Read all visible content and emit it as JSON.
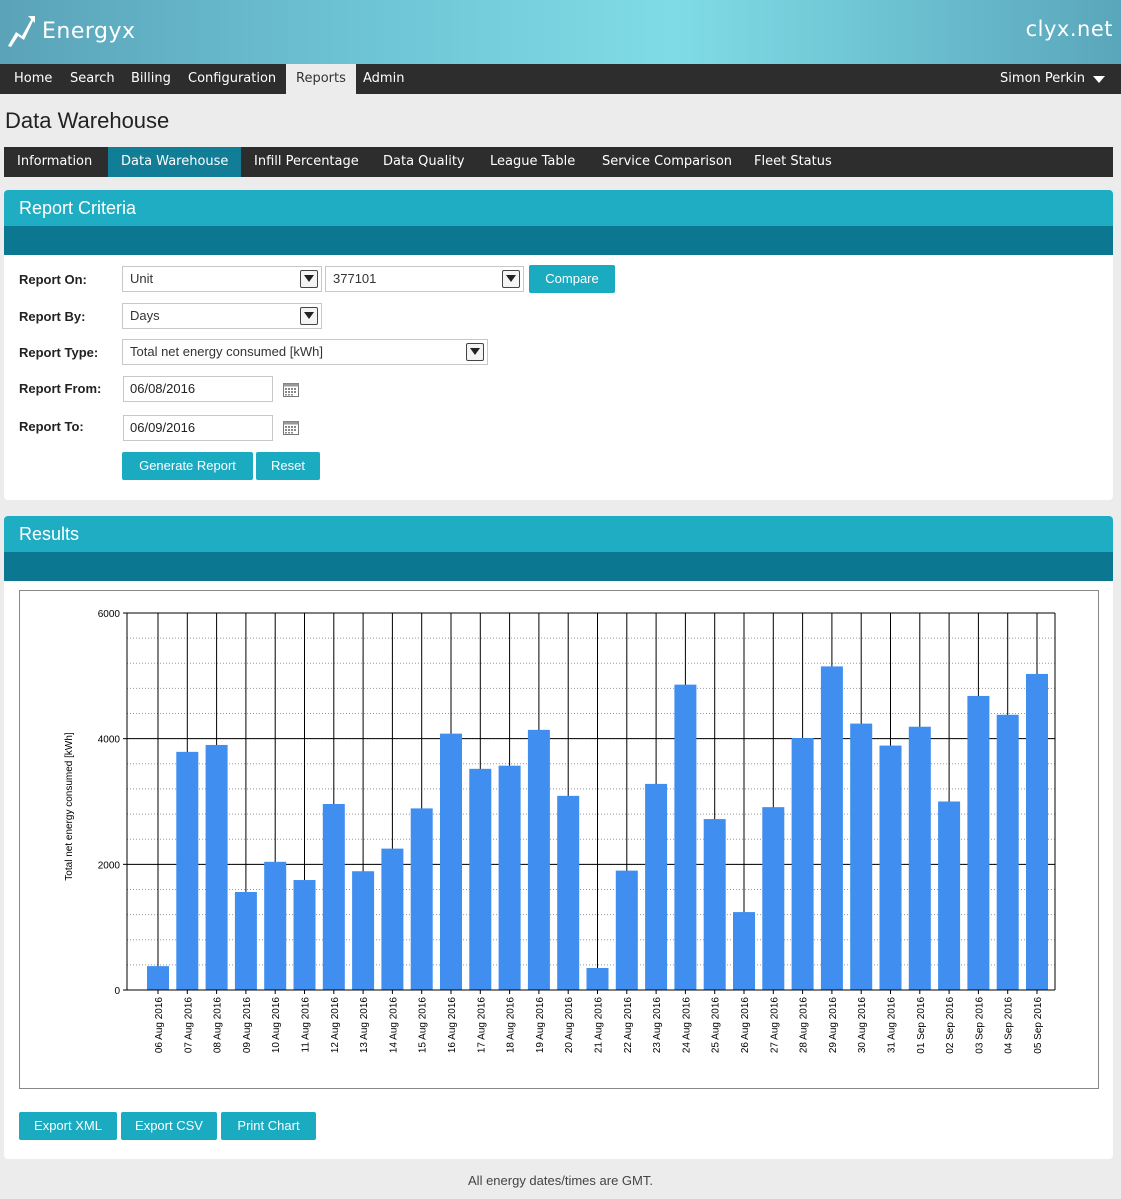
{
  "header": {
    "brand": "Energyx",
    "site": "clyx.net"
  },
  "nav": {
    "items": [
      "Home",
      "Search",
      "Billing",
      "Configuration",
      "Reports",
      "Admin"
    ],
    "active": "Reports",
    "user": "Simon Perkin"
  },
  "page_title": "Data Warehouse",
  "sub_tabs": {
    "items": [
      "Information",
      "Data Warehouse",
      "Infill Percentage",
      "Data Quality",
      "League Table",
      "Service Comparison",
      "Fleet Status"
    ],
    "active": "Data Warehouse"
  },
  "criteria": {
    "title": "Report Criteria",
    "report_on_label": "Report On:",
    "report_on_value": "Unit",
    "unit_value": "377101",
    "compare_label": "Compare",
    "report_by_label": "Report By:",
    "report_by_value": "Days",
    "report_type_label": "Report Type:",
    "report_type_value": "Total net energy consumed [kWh]",
    "report_from_label": "Report From:",
    "report_from_value": "06/08/2016",
    "report_to_label": "Report To:",
    "report_to_value": "06/09/2016",
    "generate_label": "Generate Report",
    "reset_label": "Reset"
  },
  "results": {
    "title": "Results",
    "export_xml_label": "Export XML",
    "export_csv_label": "Export CSV",
    "print_chart_label": "Print Chart"
  },
  "footer_note": "All energy dates/times are GMT.",
  "colors": {
    "accent": "#1fadc3",
    "accent_dark": "#0b7790",
    "bar": "#3f8ef0",
    "nav_bg": "#2d2d2d"
  },
  "chart_data": {
    "type": "bar",
    "title": "",
    "xlabel": "",
    "ylabel": "Total net energy consumed [kWh]",
    "ylim": [
      0,
      6000
    ],
    "yticks": [
      0,
      2000,
      4000,
      6000
    ],
    "grid": true,
    "categories": [
      "06 Aug 2016",
      "07 Aug 2016",
      "08 Aug 2016",
      "09 Aug 2016",
      "10 Aug 2016",
      "11 Aug 2016",
      "12 Aug 2016",
      "13 Aug 2016",
      "14 Aug 2016",
      "15 Aug 2016",
      "16 Aug 2016",
      "17 Aug 2016",
      "18 Aug 2016",
      "19 Aug 2016",
      "20 Aug 2016",
      "21 Aug 2016",
      "22 Aug 2016",
      "23 Aug 2016",
      "24 Aug 2016",
      "25 Aug 2016",
      "26 Aug 2016",
      "27 Aug 2016",
      "28 Aug 2016",
      "29 Aug 2016",
      "30 Aug 2016",
      "31 Aug 2016",
      "01 Sep 2016",
      "02 Sep 2016",
      "03 Sep 2016",
      "04 Sep 2016",
      "05 Sep 2016"
    ],
    "values": [
      380,
      3790,
      3900,
      1560,
      2040,
      1750,
      2960,
      1890,
      2250,
      2890,
      4080,
      3520,
      3570,
      4140,
      3090,
      350,
      1900,
      3280,
      4860,
      2720,
      1240,
      2910,
      4010,
      5150,
      4240,
      3890,
      4190,
      3000,
      4680,
      4380,
      5030
    ]
  }
}
